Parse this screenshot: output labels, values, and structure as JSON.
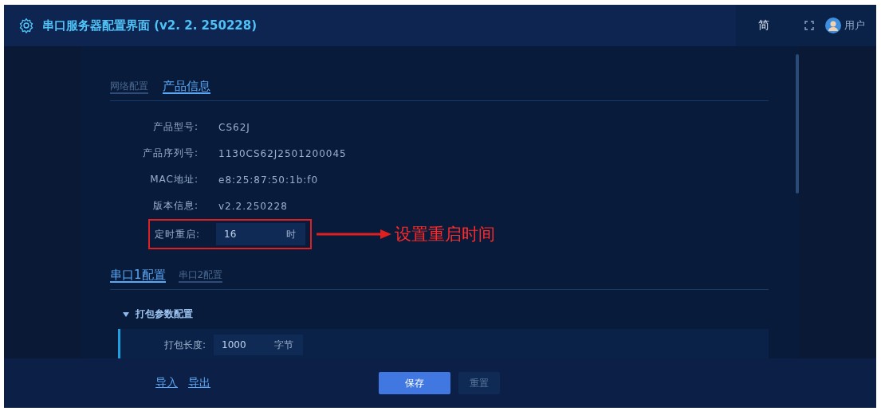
{
  "header": {
    "title": "串口服务器配置界面 (v2. 2. 250228)",
    "language": "简",
    "user": "用户"
  },
  "info_tabs": [
    {
      "label": "网络配置",
      "selected": false
    },
    {
      "label": "产品信息",
      "selected": true
    }
  ],
  "product_info": [
    {
      "label": "产品型号:",
      "value": "CS62J"
    },
    {
      "label": "产品序列号:",
      "value": "1130CS62J2501200045"
    },
    {
      "label": "MAC地址:",
      "value": "e8:25:87:50:1b:f0"
    },
    {
      "label": "版本信息:",
      "value": "v2.2.250228"
    }
  ],
  "reboot": {
    "label": "定时重启:",
    "value": "16",
    "unit": "时",
    "annotation": "设置重启时间"
  },
  "serial_tabs": [
    {
      "label": "串口1配置",
      "selected": true
    },
    {
      "label": "串口2配置",
      "selected": false
    }
  ],
  "section": {
    "title": "打包参数配置",
    "expanded": true,
    "fields": [
      {
        "label": "打包长度:",
        "value": "1000",
        "unit": "字节"
      }
    ]
  },
  "footer": {
    "links": [
      "导入",
      "导出"
    ],
    "buttons": [
      {
        "label": "保存",
        "kind": "primary"
      },
      {
        "label": "重置",
        "kind": "secondary"
      }
    ]
  }
}
